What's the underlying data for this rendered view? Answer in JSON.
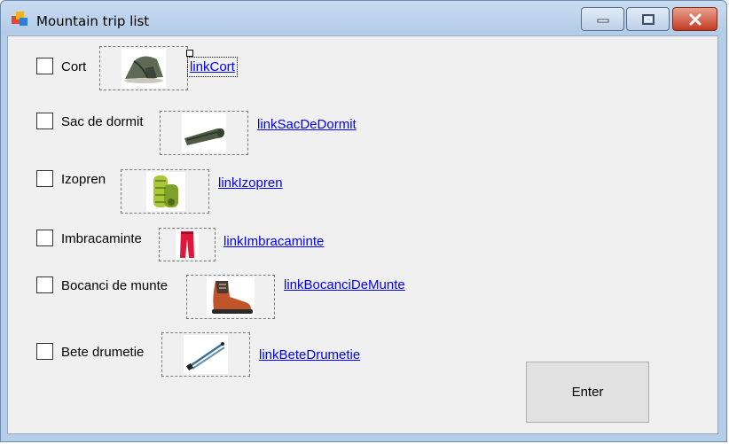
{
  "window": {
    "title": "Mountain trip list"
  },
  "controls": {
    "minimize_icon": "minimize-icon",
    "maximize_icon": "maximize-icon",
    "close_icon": "close-icon"
  },
  "items": [
    {
      "label": "Cort",
      "link": "linkCort",
      "image": "tent-image",
      "checked": false
    },
    {
      "label": "Sac de dormit",
      "link": "linkSacDeDormit",
      "image": "sleeping-bag-image",
      "checked": false
    },
    {
      "label": "Izopren",
      "link": "linkIzopren",
      "image": "sleeping-mat-image",
      "checked": false
    },
    {
      "label": "Imbracaminte",
      "link": "linkImbracaminte",
      "image": "pants-image",
      "checked": false
    },
    {
      "label": "Bocanci de munte",
      "link": "linkBocanciDeMunte",
      "image": "hiking-boot-image",
      "checked": false
    },
    {
      "label": "Bete drumetie",
      "link": "linkBeteDrumetie",
      "image": "trekking-poles-image",
      "checked": false
    }
  ],
  "enter_button": {
    "label": "Enter"
  },
  "colors": {
    "link": "#0000ff",
    "title_bar": "#b9d1ea",
    "close_button": "#c94b35",
    "form_background": "#f0f0f0"
  }
}
